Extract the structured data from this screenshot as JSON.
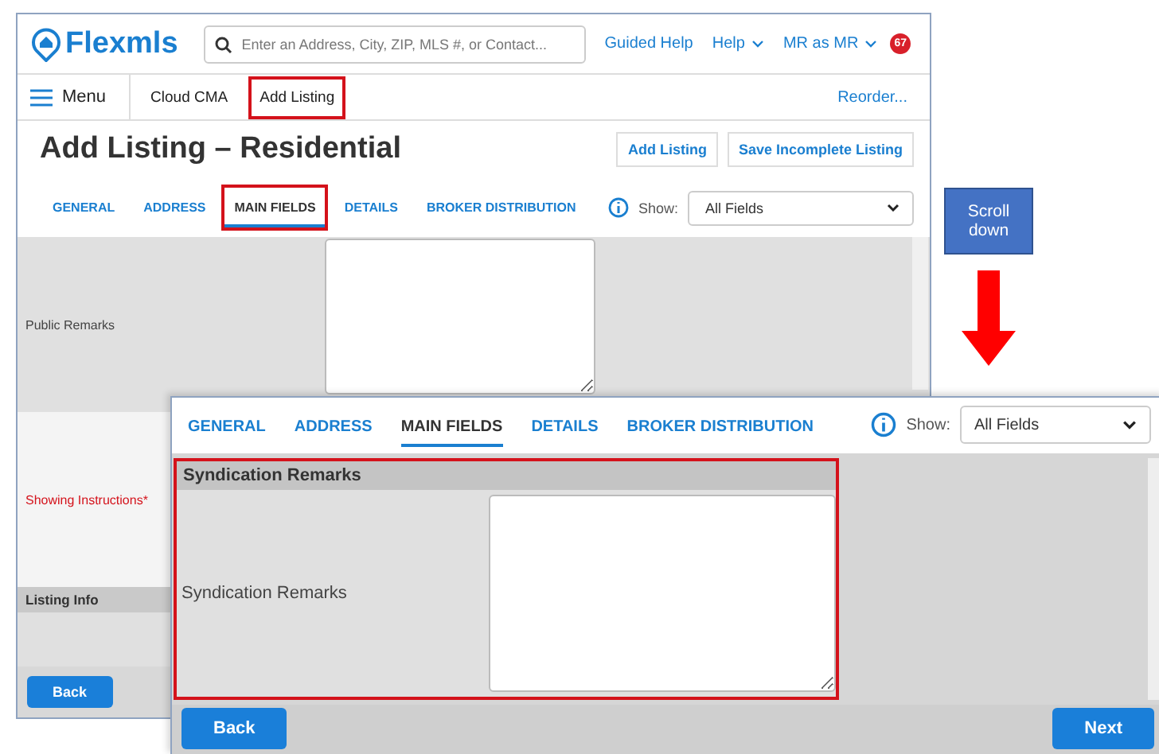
{
  "back_window": {
    "logo": "Flexmls",
    "search": {
      "placeholder": "Enter an Address, City, ZIP, MLS #, or Contact..."
    },
    "header_links": [
      {
        "label": "Guided Help",
        "kind": "link"
      },
      {
        "label": "Help",
        "kind": "dropdown"
      },
      {
        "label": "MR as MR",
        "kind": "dropdown"
      }
    ],
    "notification_count": "67",
    "menu": "Menu",
    "nav_items": [
      {
        "label": "Cloud CMA",
        "highlighted": false
      },
      {
        "label": "Add Listing",
        "highlighted": true
      }
    ],
    "reorder": "Reorder...",
    "title": "Add Listing – Residential",
    "buttons": [
      "Add Listing",
      "Save Incomplete Listing"
    ],
    "tabs": [
      {
        "label": "GENERAL",
        "selected": false,
        "highlighted": false
      },
      {
        "label": "ADDRESS",
        "selected": false,
        "highlighted": false
      },
      {
        "label": "MAIN FIELDS",
        "selected": true,
        "highlighted": true
      },
      {
        "label": "DETAILS",
        "selected": false,
        "highlighted": false
      },
      {
        "label": "BROKER DISTRIBUTION",
        "selected": false,
        "highlighted": false
      }
    ],
    "show": {
      "label": "Show:",
      "value": "All Fields"
    },
    "fields": [
      {
        "label": "Public Remarks",
        "required": false
      },
      {
        "label": "Showing Instructions*",
        "required": true
      }
    ],
    "section": "Listing Info",
    "back_button": "Back"
  },
  "annotation": {
    "note": "Scroll down"
  },
  "front_window": {
    "tabs": [
      {
        "label": "GENERAL",
        "selected": false
      },
      {
        "label": "ADDRESS",
        "selected": false
      },
      {
        "label": "MAIN FIELDS",
        "selected": true
      },
      {
        "label": "DETAILS",
        "selected": false
      },
      {
        "label": "BROKER DISTRIBUTION",
        "selected": false
      }
    ],
    "show": {
      "label": "Show:",
      "value": "All Fields"
    },
    "section": {
      "title": "Syndication Remarks",
      "highlighted": true,
      "field_label": "Syndication Remarks"
    },
    "buttons": [
      {
        "label": "Back",
        "kind": "back"
      },
      {
        "label": "Next",
        "kind": "next"
      }
    ]
  }
}
